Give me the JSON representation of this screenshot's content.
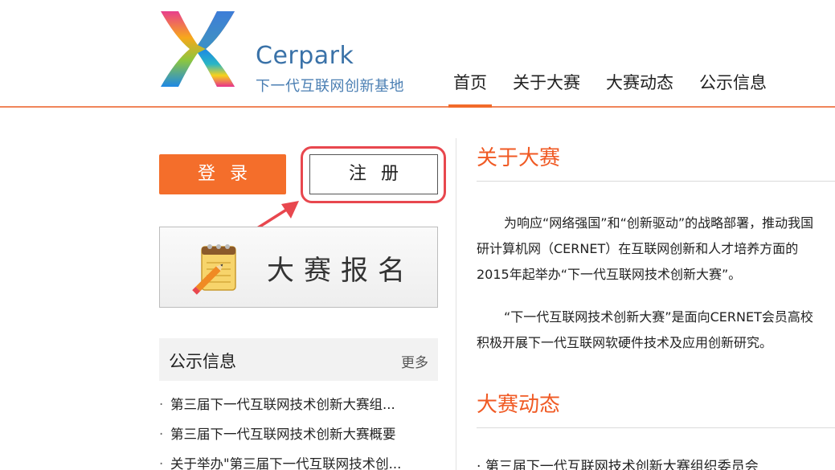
{
  "header": {
    "brand": "Cerpark",
    "tagline": "下一代互联网创新基地",
    "nav": [
      {
        "label": "首页",
        "active": true
      },
      {
        "label": "关于大赛",
        "active": false
      },
      {
        "label": "大赛动态",
        "active": false
      },
      {
        "label": "公示信息",
        "active": false
      }
    ]
  },
  "auth": {
    "login_label": "登录",
    "register_label": "注册",
    "highlight_color": "#e8474e"
  },
  "signup_banner": {
    "label": "大赛报名",
    "icon": "notepad-pencil-icon"
  },
  "notices": {
    "title": "公示信息",
    "more_label": "更多",
    "items": [
      "第三届下一代互联网技术创新大赛组...",
      "第三届下一代互联网技术创新大赛概要",
      "关于举办\"第三届下一代互联网技术创..."
    ]
  },
  "about": {
    "title": "关于大赛",
    "paragraph1": [
      "为响应“网络强国”和“创新驱动”的战略部署，推动我国",
      "研计算机网（CERNET）在互联网创新和人才培养方面的",
      "2015年起举办“下一代互联网技术创新大赛”。"
    ],
    "paragraph2": [
      "“下一代互联网技术创新大赛”是面向CERNET会员高校",
      "积极开展下一代互联网软硬件技术及应用创新研究。"
    ]
  },
  "news": {
    "title": "大赛动态",
    "items": [
      "第三届下一代互联网技术创新大赛组织委员会"
    ]
  },
  "colors": {
    "accent": "#f05a24",
    "login_bg": "#f46e2b",
    "brand_blue": "#3a72a8"
  }
}
